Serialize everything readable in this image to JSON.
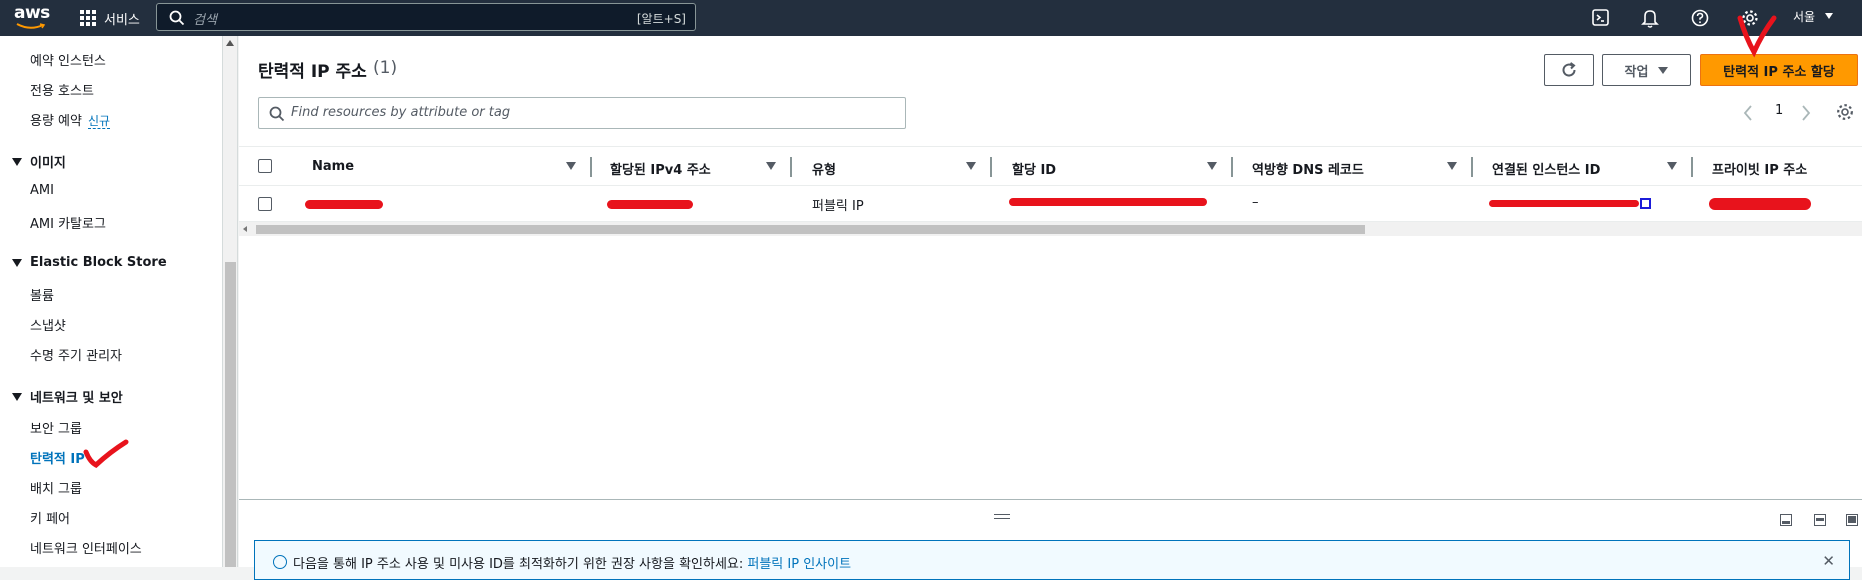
{
  "topbar": {
    "logo": "aws",
    "services_label": "서비스",
    "search_placeholder": "검색",
    "search_shortcut": "[알트+S]",
    "region_label": "서울",
    "icons": [
      "cloudshell-icon",
      "bell-icon",
      "help-icon",
      "gear-icon"
    ]
  },
  "sidebar": {
    "items_top": [
      "예약 인스턴스",
      "전용 호스트",
      "용량 예약"
    ],
    "new_badge": "신규",
    "sections": [
      {
        "title": "이미지",
        "items": [
          "AMI",
          "AMI 카탈로그"
        ]
      },
      {
        "title": "Elastic Block Store",
        "items": [
          "볼륨",
          "스냅샷",
          "수명 주기 관리자"
        ]
      },
      {
        "title": "네트워크 및 보안",
        "items": [
          "보안 그룹",
          "탄력적 IP",
          "배치 그룹",
          "키 페어",
          "네트워크 인터페이스"
        ]
      }
    ],
    "active_item": "탄력적 IP"
  },
  "main": {
    "title": "탄력적 IP 주소",
    "count": "(1)",
    "refresh_icon": "refresh-icon",
    "actions_label": "작업",
    "allocate_label": "탄력적 IP 주소 할당",
    "filter_placeholder": "Find resources by attribute or tag",
    "page_number": "1",
    "columns": [
      "Name",
      "할당된 IPv4 주소",
      "유형",
      "할당 ID",
      "역방향 DNS 레코드",
      "연결된 인스턴스 ID",
      "프라이빗 IP 주소"
    ],
    "rows": [
      {
        "name": "",
        "ipv4": "",
        "type": "퍼블릭 IP",
        "allocation_id": "",
        "reverse_dns": "–",
        "instance_id": "",
        "private_ip": ""
      }
    ]
  },
  "split_panel": {
    "info_text": "다음을 통해 IP 주소 사용 및 미사용 ID를 최적화하기 위한 권장 사항을 확인하세요: ",
    "info_link": "퍼블릭 IP 인사이트"
  },
  "colors": {
    "topbar": "#232f3e",
    "primary_button": "#ff9900",
    "link": "#0073bb",
    "annotation_red": "#e8131c"
  }
}
